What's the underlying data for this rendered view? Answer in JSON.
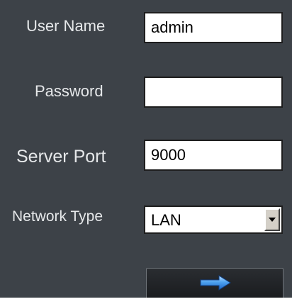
{
  "form": {
    "username_label": "User Name",
    "username_value": "admin",
    "password_label": "Password",
    "password_value": "",
    "port_label": "Server Port",
    "port_value": "9000",
    "network_label": "Network Type",
    "network_value": "LAN"
  },
  "login_button": {
    "icon": "arrow-right-icon"
  },
  "colors": {
    "panel_background": "#3d4248",
    "label_text": "#e6e8ea",
    "arrow_blue": "#3a8ee8"
  }
}
